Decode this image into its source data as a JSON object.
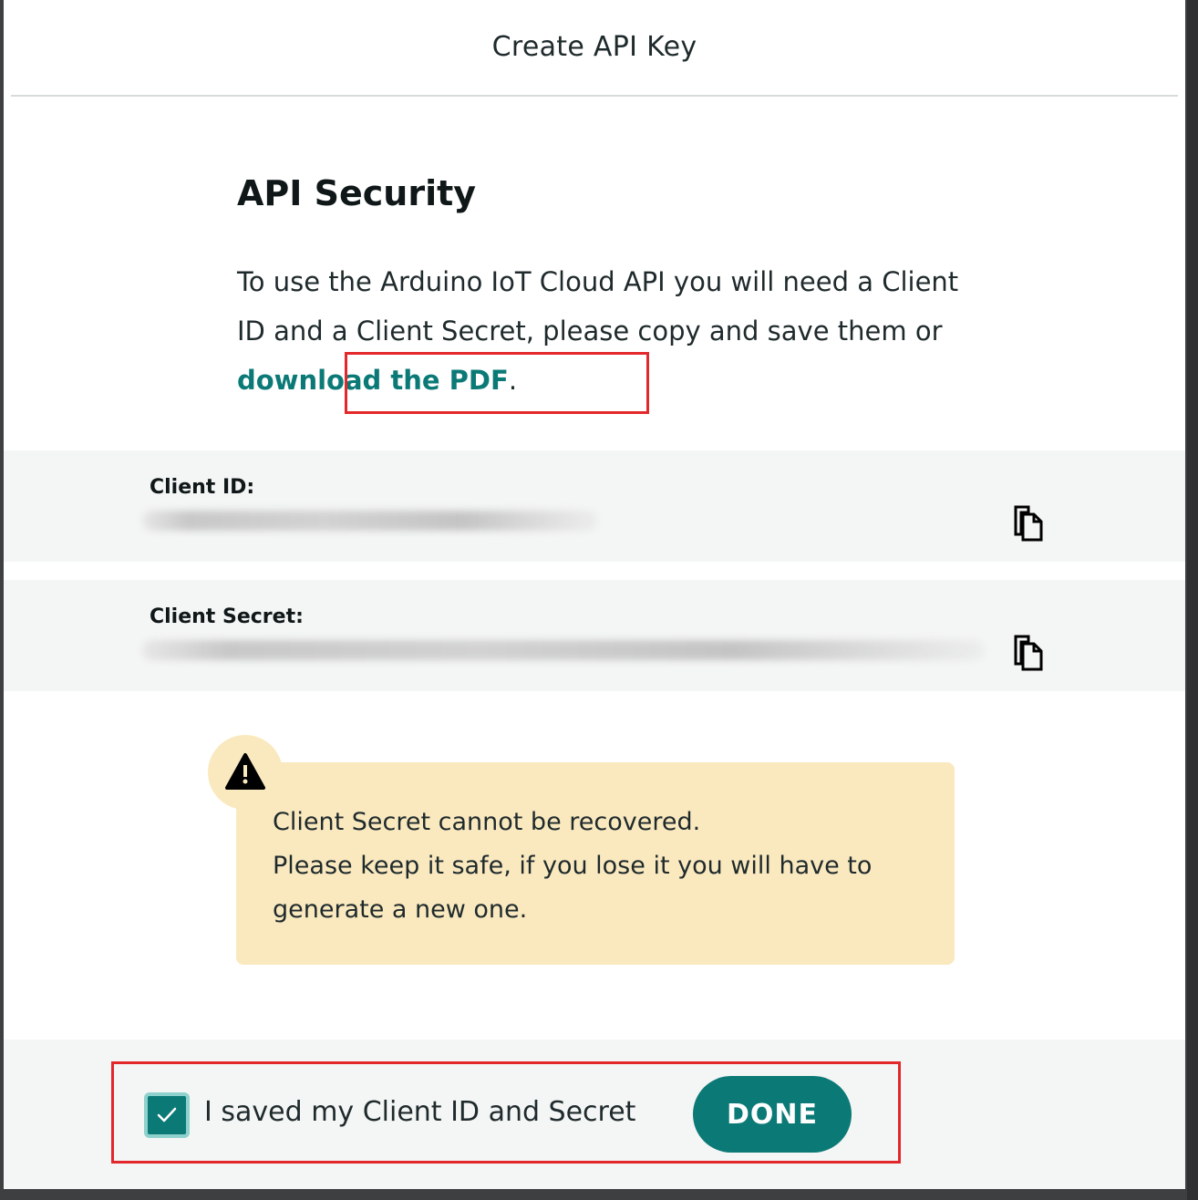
{
  "modal": {
    "title": "Create API Key"
  },
  "security": {
    "heading": "API Security",
    "intro_text": "To use the Arduino IoT Cloud API you will need a Client ID and a Client Secret, please copy and save them or ",
    "pdf_link": "download the PDF",
    "intro_end": "."
  },
  "credentials": {
    "client_id_label": "Client ID:",
    "client_secret_label": "Client Secret:"
  },
  "warning": {
    "line1": "Client Secret cannot be recovered.",
    "line2": "Please keep it safe, if you lose it you will have to generate a new one."
  },
  "footer": {
    "checkbox_label": "I saved my Client ID and Secret",
    "done_label": "DONE"
  },
  "colors": {
    "accent": "#0b7a77",
    "warning_bg": "#fae9bf",
    "highlight": "#e3282b"
  },
  "icons": {
    "copy": "copy-icon",
    "warning": "warning-triangle-icon",
    "check": "checkmark-icon"
  }
}
